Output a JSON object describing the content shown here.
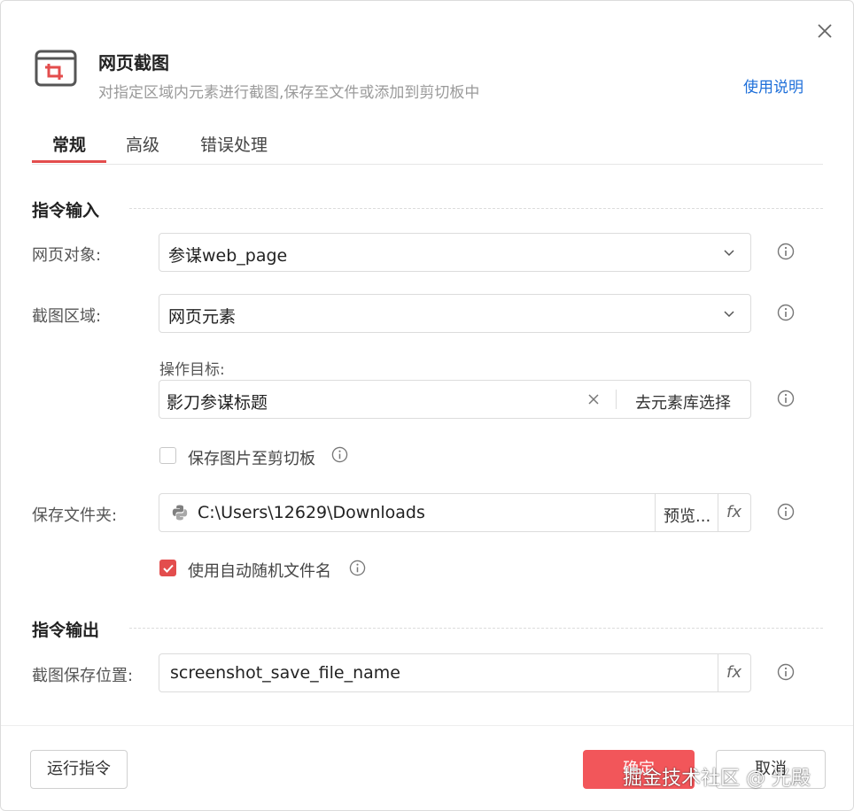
{
  "dialog": {
    "title": "网页截图",
    "subtitle": "对指定区域内元素进行截图,保存至文件或添加到剪切板中",
    "help_link": "使用说明",
    "icon": "screenshot-crop-icon",
    "close_icon": "close-icon"
  },
  "tabs": [
    {
      "label": "常规",
      "active": true
    },
    {
      "label": "高级",
      "active": false
    },
    {
      "label": "错误处理",
      "active": false
    }
  ],
  "input_section": {
    "title": "指令输入",
    "web_object": {
      "label": "网页对象:",
      "value": "参谋web_page"
    },
    "capture_area": {
      "label": "截图区域:",
      "value": "网页元素"
    },
    "operation_target": {
      "label": "操作目标:",
      "value": "影刀参谋标题",
      "pick_button": "去元素库选择"
    },
    "save_to_clipboard": {
      "label": "保存图片至剪切板",
      "checked": false
    },
    "save_folder": {
      "label": "保存文件夹:",
      "value": "C:\\Users\\12629\\Downloads",
      "browse_button": "预览...",
      "fx": "fx",
      "icon": "python-icon"
    },
    "auto_filename": {
      "label": "使用自动随机文件名",
      "checked": true
    }
  },
  "output_section": {
    "title": "指令输出",
    "save_location": {
      "label": "截图保存位置:",
      "value": "screenshot_save_file_name",
      "fx": "fx"
    }
  },
  "footer": {
    "run_button": "运行指令",
    "ok_button": "确定",
    "cancel_button": "取消",
    "watermark": "掘金技术社区 @ 光殿"
  },
  "colors": {
    "accent": "#e34d4d",
    "primary_button": "#f2565a",
    "link": "#1e6fd9"
  }
}
